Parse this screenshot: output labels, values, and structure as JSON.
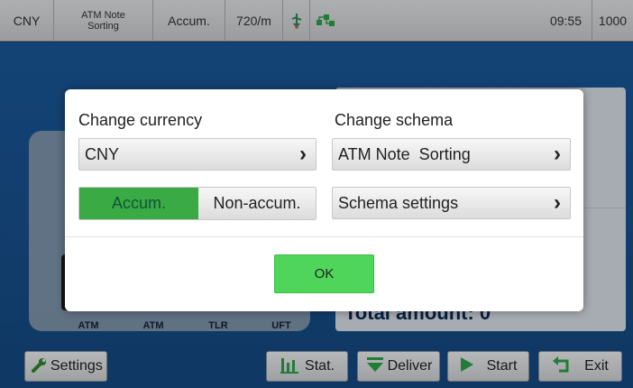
{
  "status_bar": {
    "currency": "CNY",
    "schema_line1": "ATM Note",
    "schema_line2": "Sorting",
    "mode": "Accum.",
    "speed": "720/m",
    "time": "09:55",
    "count": "1000"
  },
  "background": {
    "machines": [
      "ATM",
      "ATM",
      "TLR",
      "UFT"
    ],
    "total_label": "Total amount: 0"
  },
  "dialog": {
    "change_currency_label": "Change currency",
    "currency_value": "CNY",
    "change_schema_label": "Change schema",
    "schema_value": "ATM Note  Sorting",
    "accum_label": "Accum.",
    "non_accum_label": "Non-accum.",
    "accum_selected": "Accum.",
    "schema_settings_label": "Schema settings",
    "ok_label": "OK"
  },
  "toolbar": {
    "settings_label": "Settings",
    "stat_label": "Stat.",
    "deliver_label": "Deliver",
    "start_label": "Start",
    "exit_label": "Exit"
  },
  "colors": {
    "accent_green": "#3aaa44",
    "ok_green": "#4fd65a",
    "background_blue": "#1a5a9e"
  },
  "icons": {
    "usb": "usb-icon",
    "network": "network-icon",
    "chevron": "chevron-right-icon",
    "settings": "wrench-icon",
    "stat": "bar-chart-icon",
    "deliver": "down-arrow-icon",
    "start": "play-icon",
    "exit": "return-arrow-icon"
  }
}
